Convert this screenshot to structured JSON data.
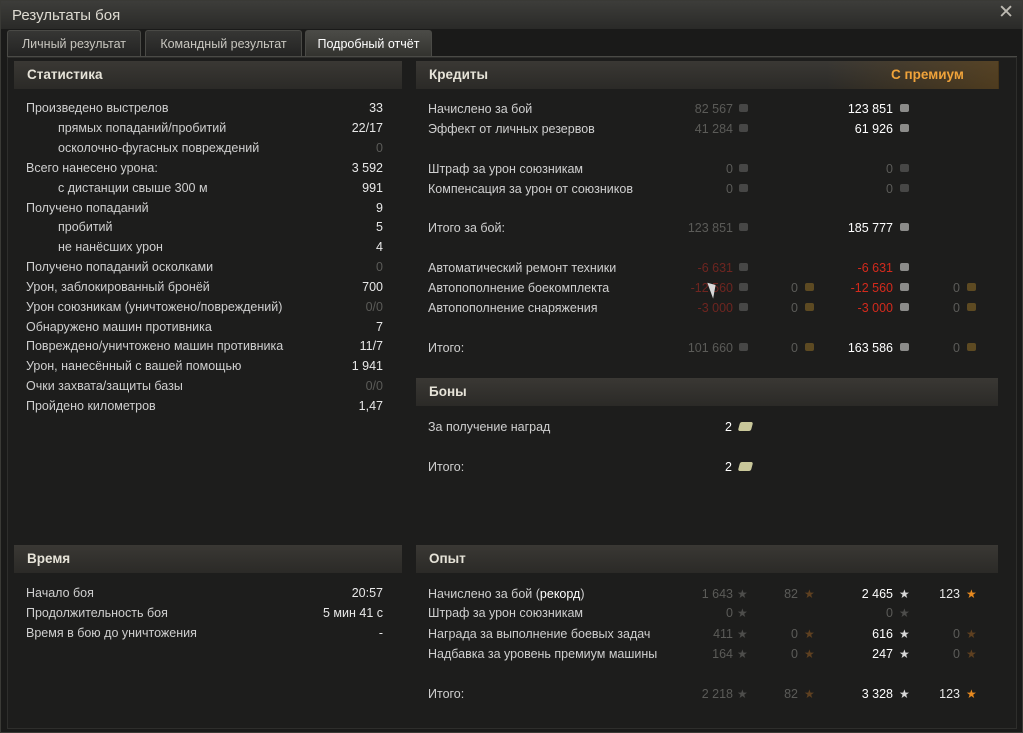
{
  "window": {
    "title": "Результаты боя",
    "close_glyph": "✕"
  },
  "tabs": [
    {
      "label": "Личный результат"
    },
    {
      "label": "Командный результат"
    },
    {
      "label": "Подробный отчёт"
    }
  ],
  "stats": {
    "header": "Статистика",
    "rows": [
      {
        "label": "Произведено выстрелов",
        "value": "33"
      },
      {
        "label": "прямых попаданий/пробитий",
        "value": "22/17"
      },
      {
        "label": "осколочно-фугасных повреждений",
        "value": "0"
      },
      {
        "label": "Всего нанесено урона:",
        "value": "3 592"
      },
      {
        "label": "с дистанции свыше 300 м",
        "value": "991"
      },
      {
        "label": "Получено попаданий",
        "value": "9"
      },
      {
        "label": "пробитий",
        "value": "5"
      },
      {
        "label": "не нанёсших урон",
        "value": "4"
      },
      {
        "label": "Получено попаданий осколками",
        "value": "0"
      },
      {
        "label": "Урон, заблокированный бронёй",
        "value": "700"
      },
      {
        "label": "Урон союзникам (уничтожено/повреждений)",
        "value": "0/0"
      },
      {
        "label": "Обнаружено машин противника",
        "value": "7"
      },
      {
        "label": "Повреждено/уничтожено машин противника",
        "value": "11/7"
      },
      {
        "label": "Урон, нанесённый с вашей помощью",
        "value": "1 941"
      },
      {
        "label": "Очки захвата/защиты базы",
        "value": "0/0"
      },
      {
        "label": "Пройдено километров",
        "value": "1,47"
      }
    ]
  },
  "time": {
    "header": "Время",
    "rows": [
      {
        "label": "Начало боя",
        "value": "20:57"
      },
      {
        "label": "Продолжительность боя",
        "value": "5 мин 41 с"
      },
      {
        "label": "Время в бою до уничтожения",
        "value": "-"
      }
    ]
  },
  "credits": {
    "header": "Кредиты",
    "premium_header": "С премиум",
    "rows": [
      {
        "label": "Начислено за бой",
        "base": "82 567",
        "premium": "123 851"
      },
      {
        "label": "Эффект от личных резервов",
        "base": "41 284",
        "premium": "61 926"
      },
      {
        "label": "Штраф за урон союзникам",
        "base": "0",
        "premium": "0"
      },
      {
        "label": "Компенсация за урон от союзников",
        "base": "0",
        "premium": "0"
      },
      {
        "label": "Итого за бой:",
        "base": "123 851",
        "premium": "185 777"
      },
      {
        "label": "Автоматический ремонт техники",
        "base": "-6 631",
        "premium": "-6 631"
      },
      {
        "label": "Автопополнение боекомплекта",
        "base": "-12 560",
        "base_gold": "0",
        "premium": "-12 560",
        "premium_gold": "0"
      },
      {
        "label": "Автопополнение снаряжения",
        "base": "-3 000",
        "base_gold": "0",
        "premium": "-3 000",
        "premium_gold": "0"
      },
      {
        "label": "Итого:",
        "base": "101 660",
        "base_gold": "0",
        "premium": "163 586",
        "premium_gold": "0"
      }
    ]
  },
  "bonds": {
    "header": "Боны",
    "rows": [
      {
        "label": "За получение наград",
        "value": "2"
      },
      {
        "label": "Итого:",
        "value": "2"
      }
    ]
  },
  "experience": {
    "header": "Опыт",
    "rows": [
      {
        "label": "Начислено за бой (",
        "record": "рекорд",
        "label_end": ")",
        "base": "1 643",
        "base_free": "82",
        "premium": "2 465",
        "premium_free": "123"
      },
      {
        "label": "Штраф за урон союзникам",
        "base": "0",
        "premium": "0"
      },
      {
        "label": "Награда за выполнение боевых задач",
        "base": "411",
        "base_free": "0",
        "premium": "616",
        "premium_free": "0"
      },
      {
        "label": "Надбавка за уровень премиум машины",
        "base": "164",
        "base_free": "0",
        "premium": "247",
        "premium_free": "0"
      },
      {
        "label": "Итого:",
        "base": "2 218",
        "base_free": "82",
        "premium": "3 328",
        "premium_free": "123"
      }
    ]
  },
  "icons": {
    "credit": "credit-coin-icon",
    "gold": "gold-coin-icon",
    "bond": "bond-icon",
    "xp": "xp-star-icon",
    "free_xp": "free-xp-star-icon"
  },
  "colors": {
    "premium_header": "#f0a33a",
    "negative": "#d32a1c",
    "free_xp_star": "#e88a1f"
  }
}
